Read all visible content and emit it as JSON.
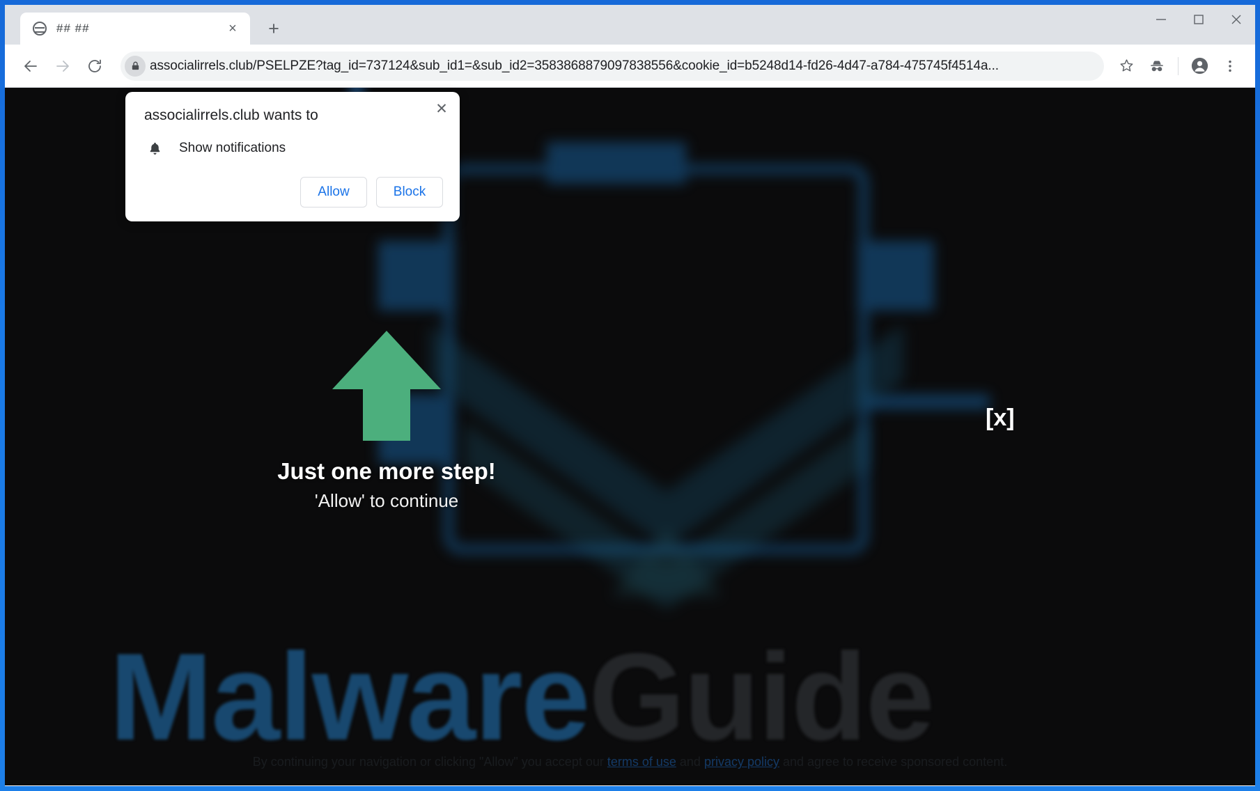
{
  "window": {
    "controls": {
      "minimize": "minimize",
      "maximize": "maximize",
      "close": "close"
    }
  },
  "tabstrip": {
    "tabs": [
      {
        "title": "## ##",
        "favicon": "globe-icon",
        "close_label": "×"
      }
    ],
    "new_tab_label": "+"
  },
  "toolbar": {
    "back": "←",
    "forward": "→",
    "reload": "↻",
    "url": "associalirrels.club/PSELPZE?tag_id=737124&sub_id1=&sub_id2=3583868879097838556&cookie_id=b5248d14-fd26-4d47-a784-475745f4514a...",
    "lock_icon": "lock-icon",
    "bookmark_icon": "star-icon",
    "incognito_icon": "incognito-icon",
    "profile_icon": "account-avatar-icon",
    "menu_icon": "three-dot-menu-icon"
  },
  "permission_dialog": {
    "title": "associalirrels.club wants to",
    "permission_icon": "bell-icon",
    "permission_label": "Show notifications",
    "allow_label": "Allow",
    "block_label": "Block",
    "close_label": "✕"
  },
  "page": {
    "arrow_icon": "up-arrow-icon",
    "arrow_color": "#4caf7d",
    "headline": "Just one more step!",
    "subhead": "'Allow' to continue",
    "corner_close": "[x]",
    "footer": {
      "part1": "By continuing your navigation or clicking \"Allow\" you accept our ",
      "link1": "terms of use",
      "part2": " and ",
      "link2": "privacy policy",
      "part3": " and agree to receive sponsored content."
    },
    "watermark": {
      "part_a": "Malware",
      "part_b": "Guide",
      "color_a": "#18486f",
      "color_b": "#242629"
    },
    "background_color": "#0b0b0c",
    "accent_color": "#123a5c"
  }
}
